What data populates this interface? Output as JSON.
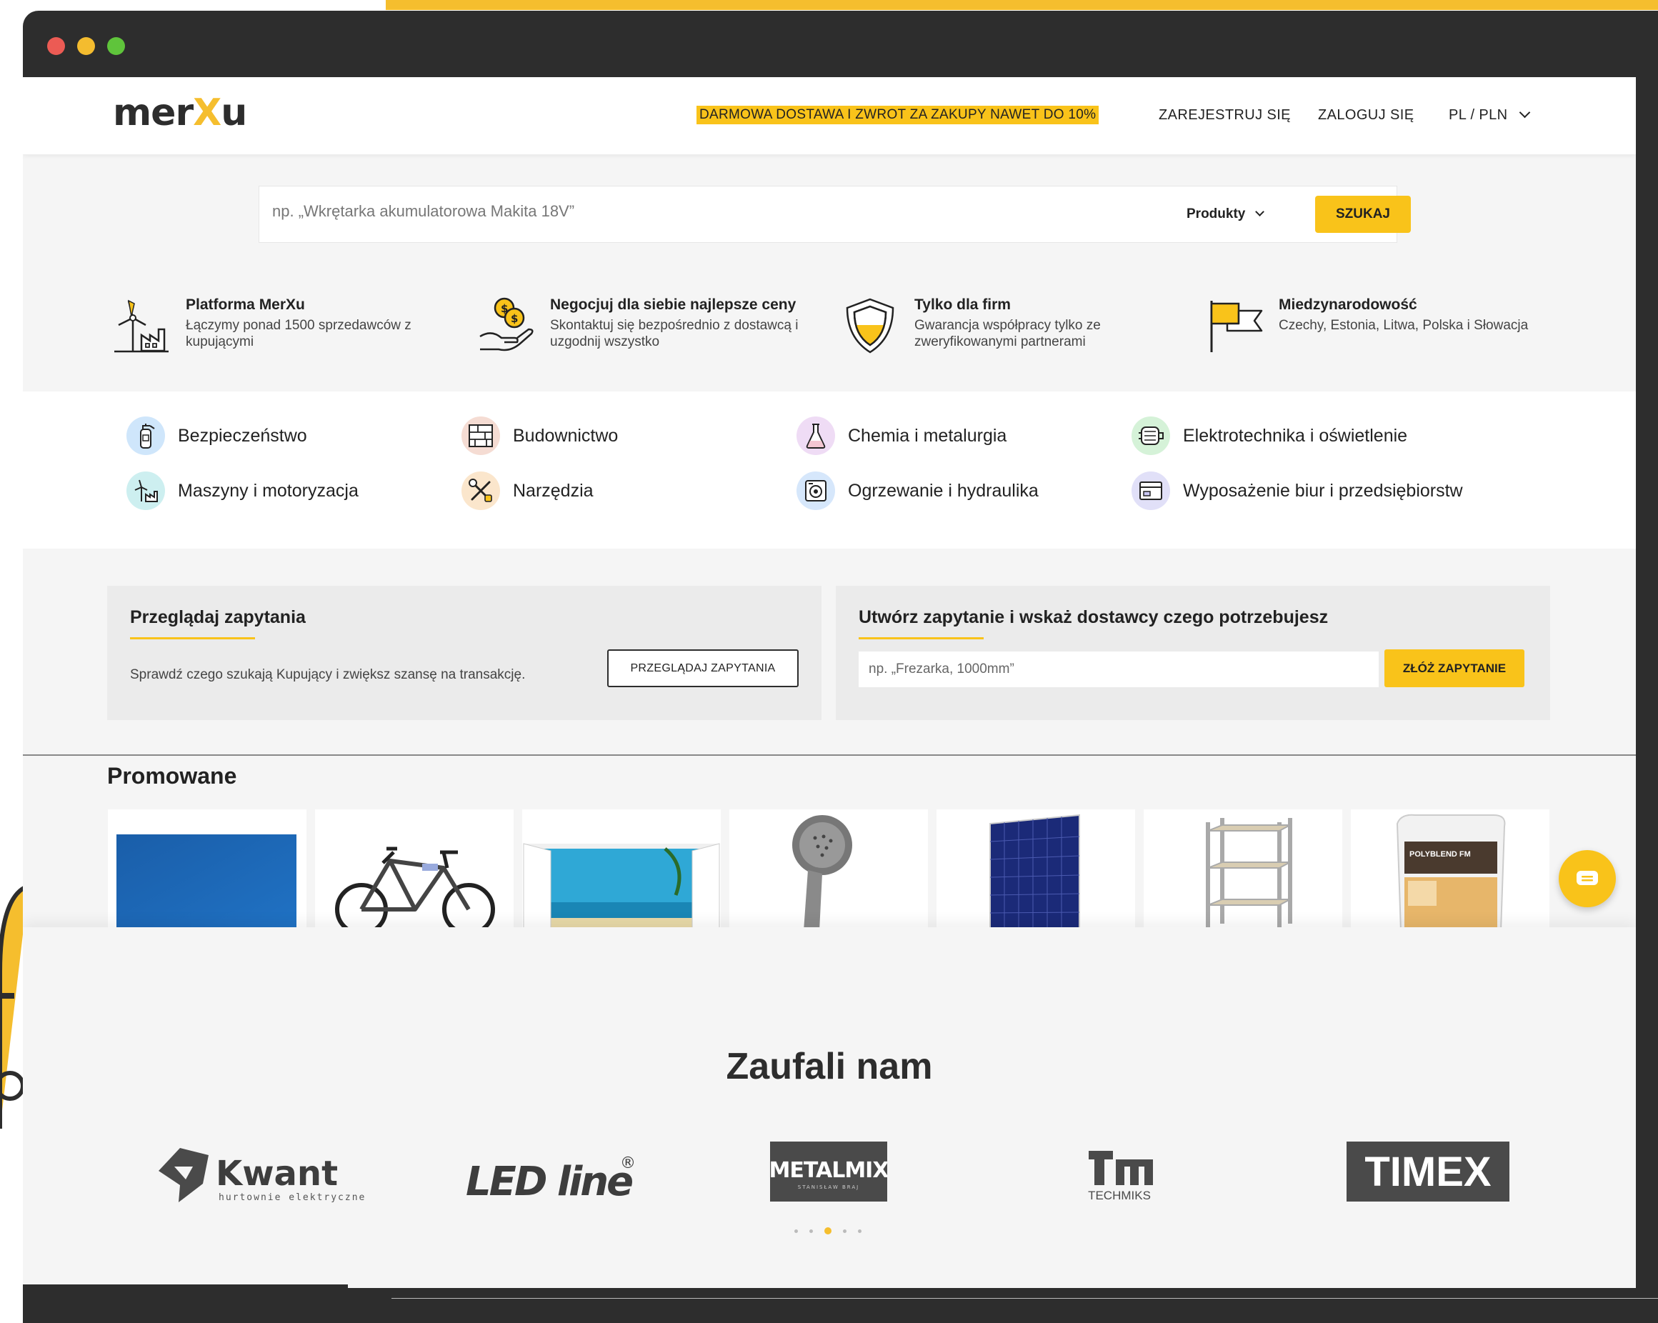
{
  "header": {
    "logo_left": "mer",
    "logo_x": "X",
    "logo_right": "u",
    "promo": "DARMOWA DOSTAWA I ZWROT ZA ZAKUPY NAWET DO 10%",
    "register": "ZAREJESTRUJ SIĘ",
    "login": "ZALOGUJ SIĘ",
    "lang": "PL / PLN"
  },
  "search": {
    "placeholder": "np. „Wkrętarka akumulatorowa Makita 18V”",
    "scope": "Produkty",
    "button": "SZUKAJ"
  },
  "features": [
    {
      "title": "Platforma MerXu",
      "desc": "Łączymy ponad 1500 sprzedawców z kupującymi",
      "icon": "wind-factory-icon"
    },
    {
      "title": "Negocjuj dla siebie najlepsze ceny",
      "desc": "Skontaktuj się bezpośrednio z dostawcą i uzgodnij wszystko",
      "icon": "coins-hand-icon"
    },
    {
      "title": "Tylko dla firm",
      "desc": "Gwarancja współpracy tylko ze zweryfikowanymi partnerami",
      "icon": "shield-icon"
    },
    {
      "title": "Miedzynarodowość",
      "desc": "Czechy, Estonia, Litwa, Polska i Słowacja",
      "icon": "flag-icon"
    }
  ],
  "categories": [
    {
      "label": "Bezpieczeństwo",
      "icon": "fire-extinguisher-icon",
      "color": "#cfe6fb"
    },
    {
      "label": "Budownictwo",
      "icon": "brick-wall-icon",
      "color": "#f5dcd3"
    },
    {
      "label": "Chemia i metalurgia",
      "icon": "flask-icon",
      "color": "#efdcf5"
    },
    {
      "label": "Elektrotechnika i oświetlenie",
      "icon": "motor-icon",
      "color": "#d5f2d8"
    },
    {
      "label": "Maszyny i motoryzacja",
      "icon": "factory-icon",
      "color": "#cdeff0"
    },
    {
      "label": "Narzędzia",
      "icon": "tools-icon",
      "color": "#fbe6cc"
    },
    {
      "label": "Ogrzewanie i hydraulika",
      "icon": "boiler-icon",
      "color": "#d6e7fb"
    },
    {
      "label": "Wyposażenie biur i przedsiębiorstw",
      "icon": "office-icon",
      "color": "#e1e0f8"
    }
  ],
  "inquiry": {
    "browse_title": "Przeglądaj zapytania",
    "browse_desc": "Sprawdź czego szukają Kupujący i zwiększ szansę na transakcję.",
    "browse_button": "PRZEGLĄDAJ ZAPYTANIA",
    "create_title": "Utwórz zapytanie i wskaż dostawcy czego potrzebujesz",
    "create_placeholder": "np. „Frezarka, 1000mm”",
    "create_button": "ZŁÓŻ ZAPYTANIE"
  },
  "promoted": {
    "title": "Promowane",
    "products": [
      "blue-panel",
      "bicycle",
      "window-sticker",
      "shower-head",
      "solar-panel",
      "metal-shelf",
      "polyblend-bag"
    ],
    "polyblend_label": "POLYBLEND FM"
  },
  "trusted": {
    "title": "Zaufali nam",
    "brands": {
      "kwant": "Kwant",
      "kwant_sub": "hurtownie elektryczne",
      "ledline": "LED line",
      "ledline_mark": "®",
      "metalmix": "METALMIX",
      "metalmix_sub": "STANISŁAW BRAJ",
      "techmiks": "TECHMIKS",
      "timex": "TIMEX"
    },
    "active_slide": 3,
    "slides": 5
  },
  "colors": {
    "accent": "#f9c31a",
    "dark": "#2d2d2d"
  }
}
